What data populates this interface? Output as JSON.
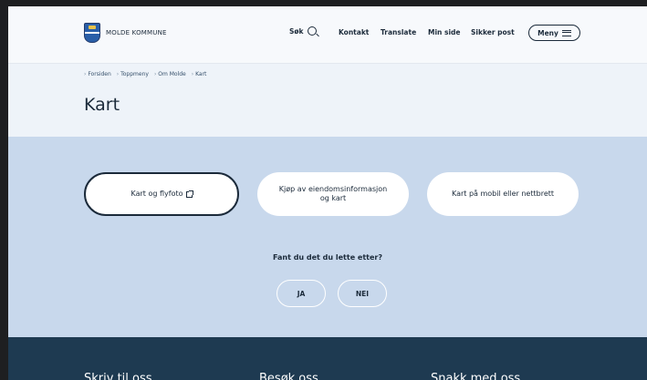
{
  "header": {
    "logo_text": "MOLDE KOMMUNE",
    "search_label": "Søk",
    "nav": [
      "Kontakt",
      "Translate",
      "Min side",
      "Sikker post"
    ],
    "menu_label": "Meny"
  },
  "breadcrumb": [
    "Forsiden",
    "Toppmeny",
    "Om Molde",
    "Kart"
  ],
  "page_title": "Kart",
  "cards": [
    {
      "label": "Kart og flyfoto",
      "icon": "external-link-icon"
    },
    {
      "label": "Kjøp av eiendomsinformasjon og kart"
    },
    {
      "label": "Kart på mobil eller nettbrett"
    }
  ],
  "feedback": {
    "question": "Fant du det du lette etter?",
    "yes": "JA",
    "no": "NEI"
  },
  "footer": {
    "headings": [
      "Skriv til oss",
      "Besøk oss",
      "Snakk med oss"
    ]
  },
  "colors": {
    "header_bg": "#f7f9fc",
    "title_bg": "#eef3f9",
    "content_bg": "#c8d8ec",
    "footer_bg": "#1e3a51",
    "text": "#1b2a3a"
  }
}
